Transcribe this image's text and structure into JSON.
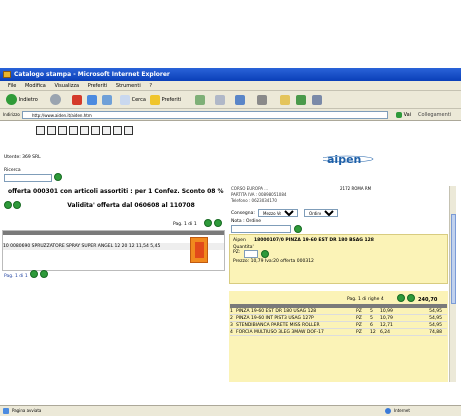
{
  "window": {
    "title": "Catalogo stampa - Microsoft Internet Explorer"
  },
  "menu": [
    "File",
    "Modifica",
    "Visualizza",
    "Preferiti",
    "Strumenti",
    "?"
  ],
  "toolbar": {
    "back": "Indietro",
    "search": "Cerca",
    "favorites": "Preferiti"
  },
  "address": {
    "label": "Indirizzo",
    "url": "http://www.aiden.it/aiden.htm",
    "go": "Vai",
    "links": "Collegamenti"
  },
  "user": {
    "label": "Utente: 369 SRL"
  },
  "search": {
    "label": "Ricerca"
  },
  "logo": {
    "text": "aipen"
  },
  "offer": {
    "line1": "offerta 000301 con articoli assortiti : per 1 Confez. Sconto 08 %",
    "line2": "Validita' offerta dal 060608 al 110708"
  },
  "pager_top": "Pag. 1 di 1",
  "pager_bottom": "Pag. 1 di 1",
  "product": {
    "row": "10 0080690 SPRUZZATORE SPRAY SUPER ANGEL   12  20 12  11,54  5,45"
  },
  "customer": {
    "line1": "CORSO EUROPA ...",
    "line2": "PARTITA IVA : 00898051084",
    "line3": "Telefono : 0623034170",
    "line4": "2172 ROMA RM"
  },
  "order_form": {
    "consegna_label": "Consegna:",
    "consegna_value": "Mezzo Vettore",
    "ordine_value": "Ordine",
    "note_label": "Nota : Ordine"
  },
  "detail": {
    "aipen": "Aipen",
    "code": "18000107/0 PINZA 19-60 EST DR 180 BSAG 128",
    "qty_label": "Quantita'",
    "pz_label": "PZ:",
    "prezzo": "Prezzo: 10,79  Iva:20  offerta 000312"
  },
  "cart": {
    "pager": "Pag. 1 di righe 4",
    "total": "240,70",
    "rows": [
      {
        "code": "1",
        "desc": "PINZA 19-60 EST DR 180 USAG 128",
        "um": "PZ",
        "qty": "5",
        "price": "10,99",
        "total": "54,95"
      },
      {
        "code": "2",
        "desc": "PINZA 19-60 INT PIST3 USAG 127P",
        "um": "PZ",
        "qty": "5",
        "price": "10,79",
        "total": "54,95"
      },
      {
        "code": "3",
        "desc": "STENDIBIANCA PARETE MISS ROLLER",
        "um": "PZ",
        "qty": "6",
        "price": "12,71",
        "total": "54,95"
      },
      {
        "code": "4",
        "desc": "FORCIA MULTIUSO 3LEG 3MAW DOF-17",
        "um": "PZ",
        "qty": "12",
        "price": "6,24",
        "total": "74,88"
      }
    ]
  },
  "status": {
    "left": "Pagina avviata",
    "right": "Internet"
  },
  "colors": {
    "titlebar": "#0a3fb8",
    "chrome": "#ece9d8",
    "yellow": "#fbf3b7",
    "green_btn": "#2e9a3a",
    "logo": "#1d5fa8"
  }
}
